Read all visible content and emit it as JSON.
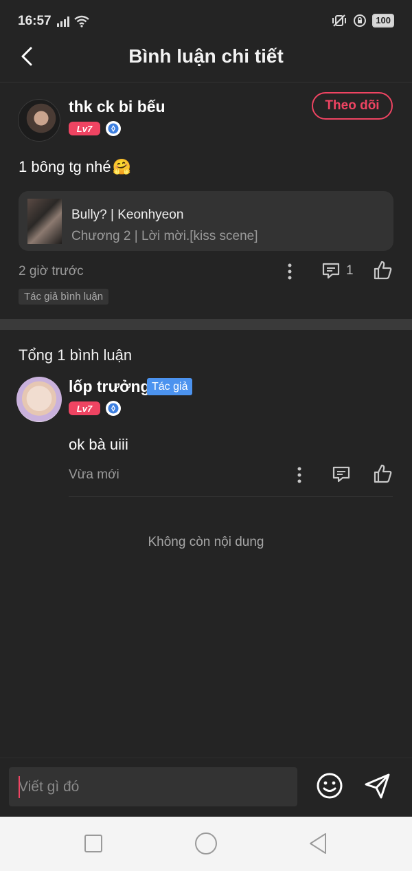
{
  "status_bar": {
    "time": "16:57",
    "battery": "100"
  },
  "header": {
    "title": "Bình luận chi tiết"
  },
  "post": {
    "user_name": "thk ck bi bếu",
    "level": "Lv7",
    "follow_label": "Theo dõi",
    "text": "1 bông tg nhé",
    "emoji": "🤗",
    "story": {
      "title": "Bully? | Keonhyeon",
      "chapter": "Chương 2 | Lời mời.[kiss scene]"
    },
    "time": "2 giờ trước",
    "reply_count": "1",
    "author_tag": "Tác giả bình luận"
  },
  "comments_section": {
    "total_label": "Tổng 1 bình luận",
    "comments": [
      {
        "user_name": "lốp trưởng",
        "author_badge": "Tác giả",
        "level": "Lv7",
        "text": "ok bà uiii",
        "time": "Vừa mới"
      }
    ],
    "end_label": "Không còn nội dung"
  },
  "input": {
    "placeholder": "Viết gì đó"
  },
  "colors": {
    "background": "#242424",
    "accent": "#ef4462",
    "author_badge": "#4c93ef",
    "card": "#333333"
  }
}
